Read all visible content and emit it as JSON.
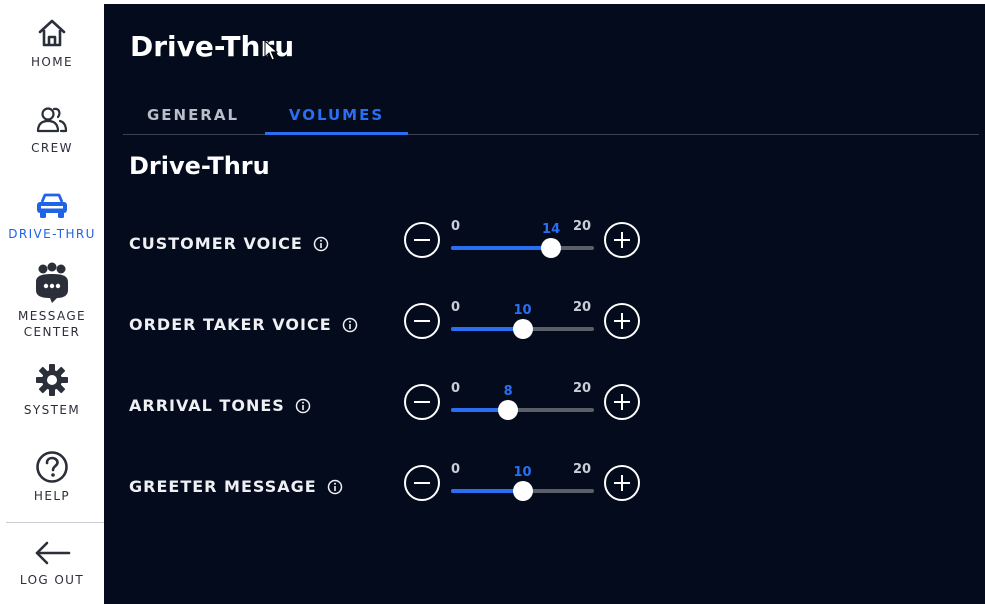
{
  "sidebar": {
    "items": [
      {
        "label": "HOME",
        "icon": "home-icon"
      },
      {
        "label": "CREW",
        "icon": "crew-icon"
      },
      {
        "label": "DRIVE-THRU",
        "icon": "car-icon",
        "active": true
      },
      {
        "label": "MESSAGE CENTER",
        "icon": "message-center-icon"
      },
      {
        "label": "SYSTEM",
        "icon": "gear-icon"
      },
      {
        "label": "HELP",
        "icon": "help-icon"
      }
    ],
    "logout": {
      "label": "LOG OUT",
      "icon": "arrow-left-icon"
    }
  },
  "header": {
    "title": "Drive-Thru"
  },
  "tabs": [
    {
      "label": "GENERAL",
      "active": false
    },
    {
      "label": "VOLUMES",
      "active": true
    }
  ],
  "section": {
    "title": "Drive-Thru"
  },
  "volumes": [
    {
      "label": "CUSTOMER VOICE",
      "min": 0,
      "max": 20,
      "value": 14
    },
    {
      "label": "ORDER TAKER VOICE",
      "min": 0,
      "max": 20,
      "value": 10
    },
    {
      "label": "ARRIVAL TONES",
      "min": 0,
      "max": 20,
      "value": 8
    },
    {
      "label": "GREETER MESSAGE",
      "min": 0,
      "max": 20,
      "value": 10
    }
  ],
  "colors": {
    "accent": "#2a6ff2",
    "panel_bg": "#030b1d",
    "sidebar_bg": "#ffffff"
  }
}
